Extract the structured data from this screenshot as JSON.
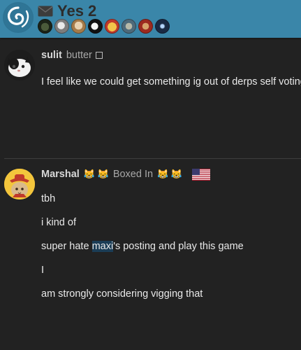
{
  "header": {
    "topic_title": "Yes 2",
    "participant_count": 8
  },
  "posts": [
    {
      "username": "sulit",
      "user_title": "butter",
      "body": [
        "I feel like we could get something ig out of derps self voting"
      ]
    },
    {
      "username": "Marshal",
      "emoji_left": "😹 😹",
      "user_title": "Boxed In",
      "emoji_right": "😹 😹",
      "flag": "US",
      "body": {
        "line1": "tbh",
        "line2": "i kind of",
        "line3_pre": "super hate ",
        "line3_hl": "maxi",
        "line3_post": "'s posting and play this game",
        "line4": "I",
        "line5": "am strongly considering vigging that"
      }
    }
  ]
}
